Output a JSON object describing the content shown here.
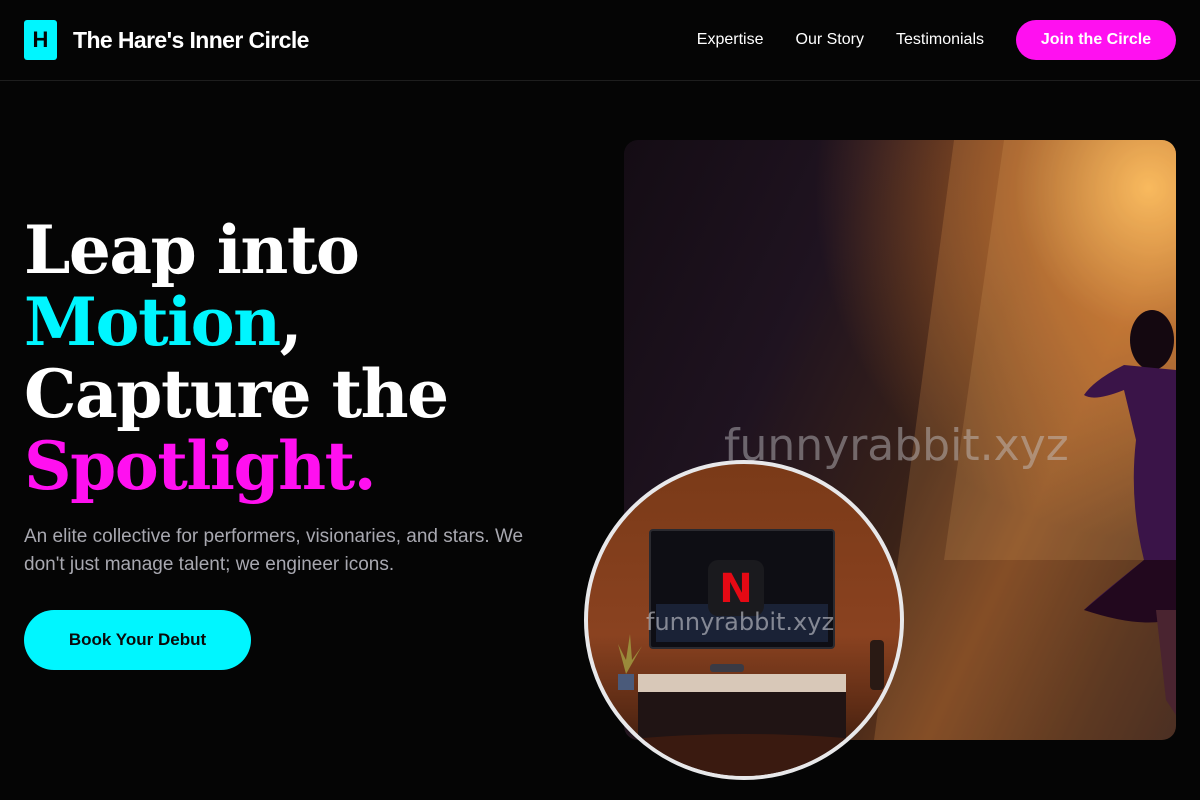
{
  "brand": {
    "logo_letter": "H",
    "name": "The Hare's Inner Circle"
  },
  "nav": {
    "links": [
      "Expertise",
      "Our Story",
      "Testimonials"
    ],
    "cta": "Join the Circle"
  },
  "hero": {
    "title_line1": "Leap into",
    "title_line2_highlight": "Motion",
    "title_line2_rest": ",",
    "title_line3": "Capture the",
    "title_line4_highlight": "Spotlight.",
    "subtitle": "An elite collective for performers, visionaries, and stars. We don't just manage talent; we engineer icons.",
    "cta": "Book Your Debut"
  },
  "images": {
    "watermark": "funnyrabbit.xyz",
    "tv_logo": "N"
  },
  "colors": {
    "accent_cyan": "#00f6ff",
    "accent_magenta": "#ff10f0",
    "background": "#050505"
  }
}
